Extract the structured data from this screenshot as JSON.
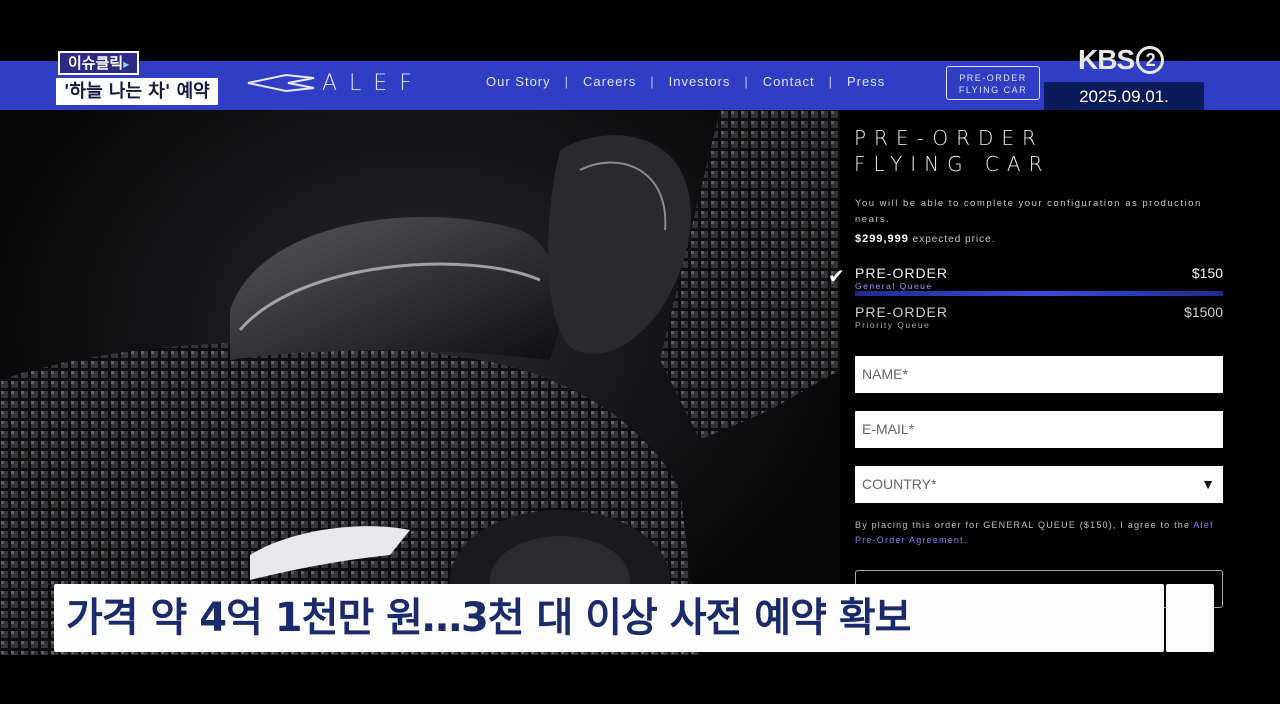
{
  "broadcast": {
    "tag": "이슈클릭",
    "headline": "'하늘 나는 차' 예약",
    "channel": "KBS",
    "channel_number": "2",
    "date": "2025.09.01.",
    "subtitle": "가격 약 4억 1천만 원…3천 대 이상 사전 예약 확보"
  },
  "site": {
    "logo": "ALEF",
    "nav": [
      "Our Story",
      "Careers",
      "Investors",
      "Contact",
      "Press"
    ],
    "nav_separator": "|",
    "preorder_button": [
      "PRE-ORDER",
      "FLYING CAR"
    ]
  },
  "form": {
    "title_line1": "PRE-ORDER",
    "title_line2": "FLYING CAR",
    "description": "You will be able to complete your configuration as production nears.",
    "price": "$299,999",
    "price_suffix": "expected price.",
    "options": [
      {
        "name": "PRE-ORDER",
        "queue": "General Queue",
        "amount": "$150",
        "selected": true
      },
      {
        "name": "PRE-ORDER",
        "queue": "Priority Queue",
        "amount": "$1500",
        "selected": false
      }
    ],
    "name_placeholder": "NAME*",
    "email_placeholder": "E-MAIL*",
    "country_placeholder": "COUNTRY*",
    "agreement_text": "By placing this order for GENERAL QUEUE ($150), I agree to the",
    "agreement_link": "Alef Pre-Order Agreement",
    "agreement_end": "."
  },
  "colors": {
    "nav_bar": "#2f3ec4",
    "accent": "#3c4be0",
    "subtitle_text": "#1a2a6a"
  }
}
